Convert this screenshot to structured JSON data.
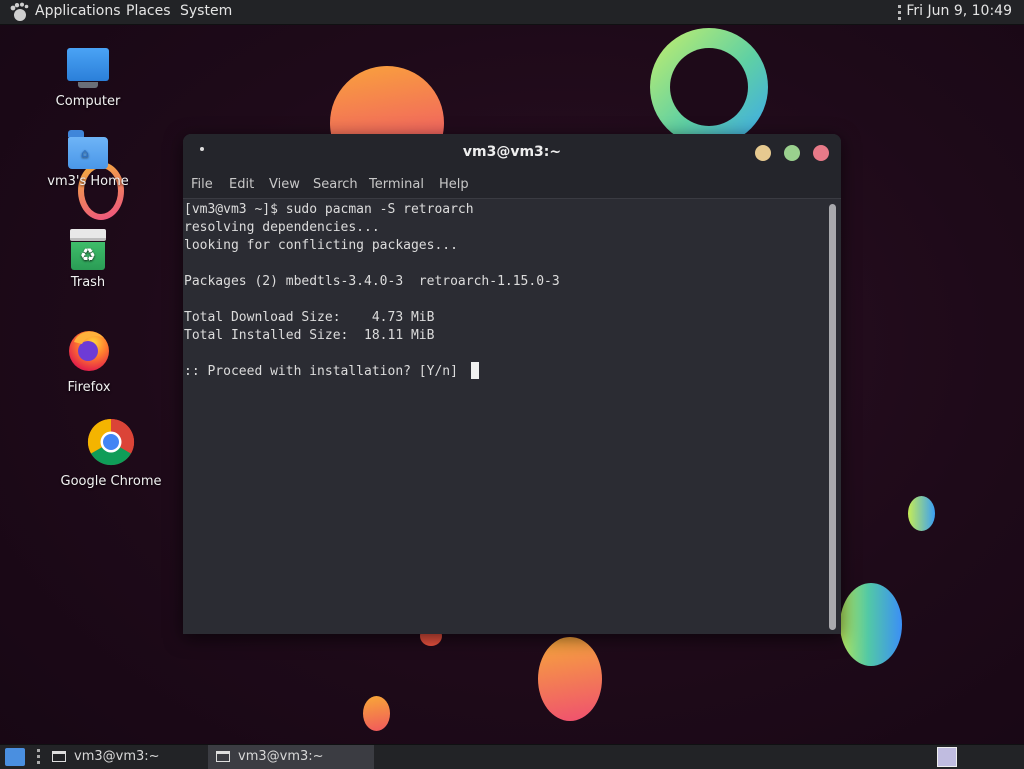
{
  "top_panel": {
    "menus": [
      "Applications",
      "Places",
      "System"
    ],
    "clock": "Fri Jun  9, 10:49"
  },
  "desktop": {
    "icons": [
      {
        "label": "Computer",
        "icon": "computer-icon"
      },
      {
        "label": "vm3's Home",
        "icon": "home-folder-icon"
      },
      {
        "label": "Trash",
        "icon": "trash-icon"
      },
      {
        "label": "Firefox",
        "icon": "firefox-icon"
      },
      {
        "label": "Google Chrome",
        "icon": "chrome-icon"
      }
    ]
  },
  "terminal": {
    "title": "vm3@vm3:~",
    "menu": [
      "File",
      "Edit",
      "View",
      "Search",
      "Terminal",
      "Help"
    ],
    "lines": [
      "[vm3@vm3 ~]$ sudo pacman -S retroarch",
      "resolving dependencies...",
      "looking for conflicting packages...",
      "",
      "Packages (2) mbedtls-3.4.0-3  retroarch-1.15.0-3",
      "",
      "Total Download Size:    4.73 MiB",
      "Total Installed Size:  18.11 MiB",
      "",
      ":: Proceed with installation? [Y/n] "
    ]
  },
  "taskbar": {
    "tasks": [
      {
        "label": "vm3@vm3:~",
        "active": false
      },
      {
        "label": "vm3@vm3:~",
        "active": true
      }
    ]
  },
  "colors": {
    "panel": "#222326",
    "terminal_bg": "#2b2c33",
    "close": "#e77a88",
    "maximize": "#9ad08e",
    "minimize": "#e6c990"
  }
}
